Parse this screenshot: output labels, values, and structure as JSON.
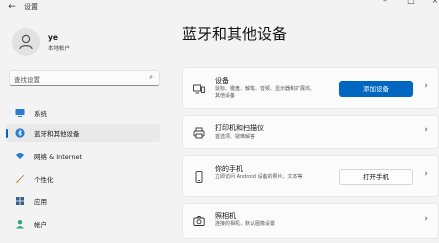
{
  "window": {
    "back_glyph": "←",
    "title": "设置",
    "min_glyph": "–",
    "max_glyph": "□",
    "close_glyph": "×"
  },
  "profile": {
    "name": "ye",
    "account_type": "本地帐户"
  },
  "search": {
    "placeholder": "查找设置",
    "icon_glyph": "⌕"
  },
  "nav": {
    "items": [
      {
        "label": "系统",
        "icon": "monitor-icon"
      },
      {
        "label": "蓝牙和其他设备",
        "icon": "bluetooth-icon",
        "active": true
      },
      {
        "label": "网络 & Internet",
        "icon": "wifi-icon"
      },
      {
        "label": "个性化",
        "icon": "brush-icon"
      },
      {
        "label": "应用",
        "icon": "apps-icon"
      },
      {
        "label": "帐户",
        "icon": "person-icon"
      }
    ]
  },
  "main": {
    "title": "蓝牙和其他设备",
    "cards": [
      {
        "title": "设备",
        "desc": "鼠标、键盘、触笔、音频、显示器和扩展坞、其他设备",
        "button": "添加设备",
        "icon": "devices-icon"
      },
      {
        "title": "打印机和扫描仪",
        "desc": "首选项、疑难解答",
        "icon": "printer-icon"
      },
      {
        "title": "你的手机",
        "desc": "立即访问 Android 设备的照片、文本等",
        "button": "打开手机",
        "icon": "phone-icon"
      },
      {
        "title": "照相机",
        "desc": "连接的相机，默认图像设置",
        "icon": "camera-icon"
      }
    ],
    "chevron_glyph": "›"
  },
  "colors": {
    "accent": "#0067c0",
    "background": "#f3f3f3",
    "card": "#fbfbfb"
  }
}
